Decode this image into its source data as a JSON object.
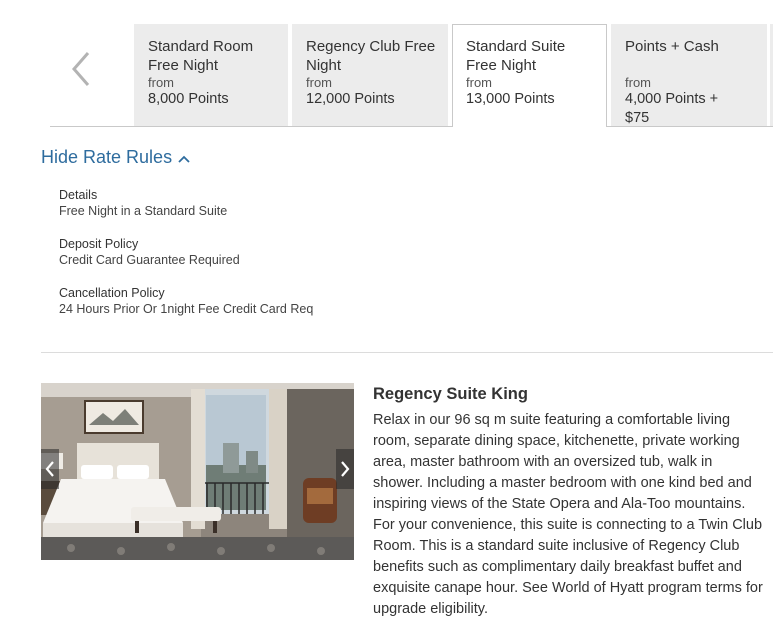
{
  "tabs": [
    {
      "title": "Standard Room Free Night",
      "from": "from",
      "price": "8,000 Points",
      "active": false
    },
    {
      "title": "Regency Club Free Night",
      "from": "from",
      "price": "12,000 Points",
      "active": false
    },
    {
      "title": "Standard Suite Free Night",
      "from": "from",
      "price": "13,000 Points",
      "active": true
    },
    {
      "title": "Points + Cash",
      "from": "from",
      "price": "4,000 Points + $75",
      "active": false
    }
  ],
  "rate_rules": {
    "toggle_label": "Hide Rate Rules",
    "details_label": "Details",
    "details_value": "Free Night in a Standard Suite",
    "deposit_label": "Deposit Policy",
    "deposit_value": "Credit Card Guarantee Required",
    "cancellation_label": "Cancellation Policy",
    "cancellation_value": "24 Hours Prior Or 1night Fee Credit Card Req"
  },
  "room": {
    "title": "Regency Suite King",
    "description": "Relax in our 96 sq m suite featuring a comfortable living room, separate dining space, kitchenette, private working area, master bathroom with an oversized tub, walk in shower. Including a master bedroom with one kind bed and inspiring views of the State Opera and Ala-Too mountains. For your convenience, this suite is connecting to a Twin Club Room. This is a standard suite inclusive of Regency Club benefits such as complimentary daily breakfast buffet and exquisite canape hour. See World of Hyatt program terms for upgrade eligibility."
  },
  "colors": {
    "link": "#2e6c9e",
    "tab_bg": "#ececec",
    "border": "#c9c9c9"
  },
  "icons": {
    "prev_tabs": "chevron-left-icon",
    "toggle": "chevron-up-icon",
    "image_prev": "chevron-left-icon",
    "image_next": "chevron-right-icon"
  }
}
